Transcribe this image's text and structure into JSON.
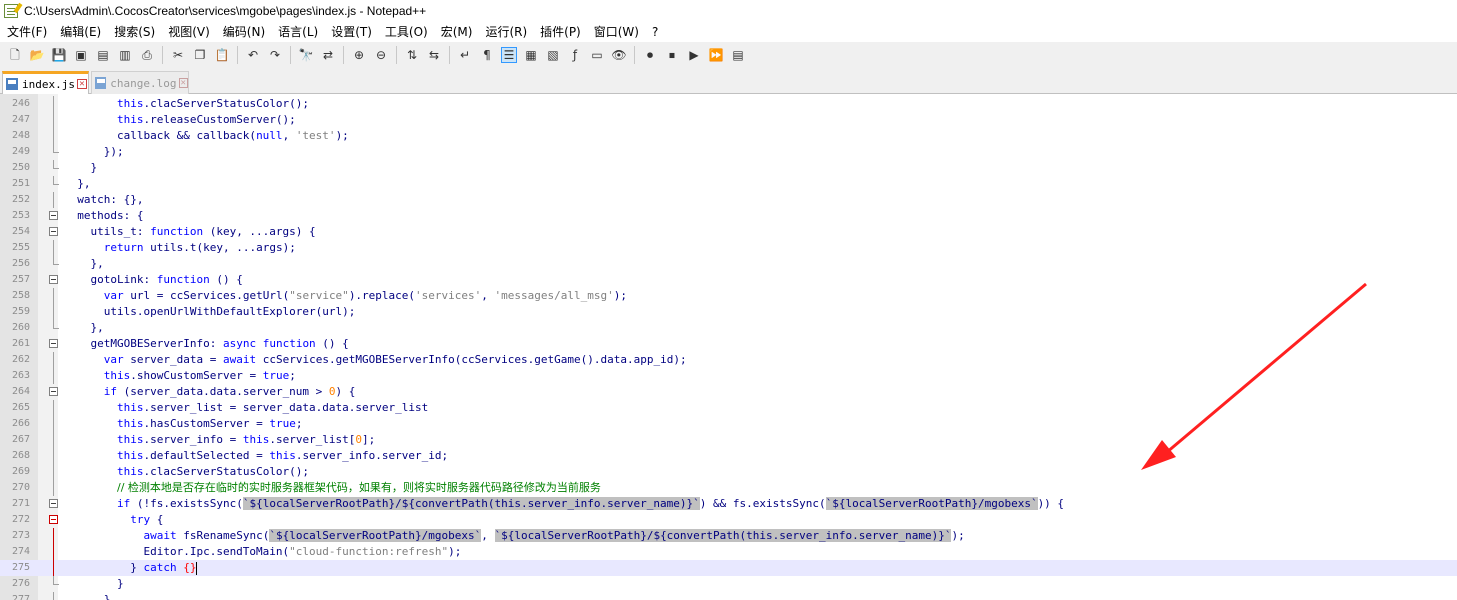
{
  "window": {
    "title": "C:\\Users\\Admin\\.CocosCreator\\services\\mgobe\\pages\\index.js - Notepad++"
  },
  "menu": [
    "文件(F)",
    "编辑(E)",
    "搜索(S)",
    "视图(V)",
    "编码(N)",
    "语言(L)",
    "设置(T)",
    "工具(O)",
    "宏(M)",
    "运行(R)",
    "插件(P)",
    "窗口(W)",
    "?"
  ],
  "tabs": [
    {
      "label": "index.js",
      "close": "✕"
    },
    {
      "label": "change.log",
      "close": "✕"
    }
  ],
  "lines": [
    {
      "num": "246",
      "code": [
        [
          "        ",
          ""
        ],
        [
          "this",
          "kw"
        ],
        [
          ".clacServerStatusColor();",
          ""
        ]
      ]
    },
    {
      "num": "247",
      "code": [
        [
          "        ",
          ""
        ],
        [
          "this",
          "kw"
        ],
        [
          ".releaseCustomServer();",
          ""
        ]
      ]
    },
    {
      "num": "248",
      "code": [
        [
          "        callback && callback(",
          ""
        ],
        [
          "null",
          "kw"
        ],
        [
          ", ",
          ""
        ],
        [
          "'test'",
          "str"
        ],
        [
          ");",
          ""
        ]
      ]
    },
    {
      "num": "249",
      "code": [
        [
          "      });",
          ""
        ]
      ]
    },
    {
      "num": "250",
      "code": [
        [
          "    }",
          ""
        ]
      ]
    },
    {
      "num": "251",
      "code": [
        [
          "  },",
          ""
        ]
      ]
    },
    {
      "num": "252",
      "code": [
        [
          "  watch: {},",
          ""
        ]
      ]
    },
    {
      "num": "253",
      "code": [
        [
          "  methods: {",
          ""
        ]
      ]
    },
    {
      "num": "254",
      "code": [
        [
          "    utils_t: ",
          ""
        ],
        [
          "function",
          "kw"
        ],
        [
          " (key, ...args) {",
          ""
        ]
      ]
    },
    {
      "num": "255",
      "code": [
        [
          "      ",
          ""
        ],
        [
          "return",
          "kw"
        ],
        [
          " utils.t(key, ...args);",
          ""
        ]
      ]
    },
    {
      "num": "256",
      "code": [
        [
          "    },",
          ""
        ]
      ]
    },
    {
      "num": "257",
      "code": [
        [
          "    gotoLink: ",
          ""
        ],
        [
          "function",
          "kw"
        ],
        [
          " () {",
          ""
        ]
      ]
    },
    {
      "num": "258",
      "code": [
        [
          "      ",
          ""
        ],
        [
          "var",
          "kw"
        ],
        [
          " url = ccServices.getUrl(",
          ""
        ],
        [
          "\"service\"",
          "str"
        ],
        [
          ").replace(",
          ""
        ],
        [
          "'services'",
          "str"
        ],
        [
          ", ",
          ""
        ],
        [
          "'messages/all_msg'",
          "str"
        ],
        [
          ");",
          ""
        ]
      ]
    },
    {
      "num": "259",
      "code": [
        [
          "      utils.openUrlWithDefaultExplorer(url);",
          ""
        ]
      ]
    },
    {
      "num": "260",
      "code": [
        [
          "    },",
          ""
        ]
      ]
    },
    {
      "num": "261",
      "code": [
        [
          "    getMGOBEServerInfo: ",
          ""
        ],
        [
          "async",
          "kw"
        ],
        [
          " ",
          ""
        ],
        [
          "function",
          "kw"
        ],
        [
          " () {",
          ""
        ]
      ]
    },
    {
      "num": "262",
      "code": [
        [
          "      ",
          ""
        ],
        [
          "var",
          "kw"
        ],
        [
          " server_data = ",
          ""
        ],
        [
          "await",
          "kw"
        ],
        [
          " ccServices.getMGOBEServerInfo(ccServices.getGame().data.app_id);",
          ""
        ]
      ]
    },
    {
      "num": "263",
      "code": [
        [
          "      ",
          ""
        ],
        [
          "this",
          "kw"
        ],
        [
          ".showCustomServer = ",
          ""
        ],
        [
          "true",
          "kw"
        ],
        [
          ";",
          ""
        ]
      ]
    },
    {
      "num": "264",
      "code": [
        [
          "      ",
          ""
        ],
        [
          "if",
          "kw"
        ],
        [
          " (server_data.data.server_num > ",
          ""
        ],
        [
          "0",
          "num"
        ],
        [
          ") {",
          ""
        ]
      ]
    },
    {
      "num": "265",
      "code": [
        [
          "        ",
          ""
        ],
        [
          "this",
          "kw"
        ],
        [
          ".server_list = server_data.data.server_list",
          ""
        ]
      ]
    },
    {
      "num": "266",
      "code": [
        [
          "        ",
          ""
        ],
        [
          "this",
          "kw"
        ],
        [
          ".hasCustomServer = ",
          ""
        ],
        [
          "true",
          "kw"
        ],
        [
          ";",
          ""
        ]
      ]
    },
    {
      "num": "267",
      "code": [
        [
          "        ",
          ""
        ],
        [
          "this",
          "kw"
        ],
        [
          ".server_info = ",
          ""
        ],
        [
          "this",
          "kw"
        ],
        [
          ".server_list[",
          ""
        ],
        [
          "0",
          "num"
        ],
        [
          "];",
          ""
        ]
      ]
    },
    {
      "num": "268",
      "code": [
        [
          "        ",
          ""
        ],
        [
          "this",
          "kw"
        ],
        [
          ".defaultSelected = ",
          ""
        ],
        [
          "this",
          "kw"
        ],
        [
          ".server_info.server_id;",
          ""
        ]
      ]
    },
    {
      "num": "269",
      "code": [
        [
          "        ",
          ""
        ],
        [
          "this",
          "kw"
        ],
        [
          ".clacServerStatusColor();",
          ""
        ]
      ]
    },
    {
      "num": "270",
      "code": [
        [
          "        ",
          ""
        ],
        [
          "// 检测本地是否存在临时的实时服务器框架代码，如果有，则将实时服务器代码路径修改为当前服务",
          "cmt"
        ]
      ]
    },
    {
      "num": "271",
      "code": [
        [
          "        ",
          ""
        ],
        [
          "if",
          "kw"
        ],
        [
          " (!fs.existsSync(",
          ""
        ],
        [
          "`${localServerRootPath}/${convertPath(this.server_info.server_name)}`",
          "tpl"
        ],
        [
          ") && fs.existsSync(",
          ""
        ],
        [
          "`${localServerRootPath}/mgobexs`",
          "tpl"
        ],
        [
          ")) {",
          ""
        ]
      ]
    },
    {
      "num": "272",
      "code": [
        [
          "          ",
          ""
        ],
        [
          "try",
          "kw"
        ],
        [
          " {",
          ""
        ]
      ]
    },
    {
      "num": "273",
      "code": [
        [
          "            ",
          ""
        ],
        [
          "await",
          "kw"
        ],
        [
          " fsRenameSync(",
          ""
        ],
        [
          "`${localServerRootPath}/mgobexs`",
          "tpl"
        ],
        [
          ", ",
          ""
        ],
        [
          "`${localServerRootPath}/${convertPath(this.server_info.server_name)}`",
          "tpl"
        ],
        [
          ");",
          ""
        ]
      ]
    },
    {
      "num": "274",
      "code": [
        [
          "            Editor.Ipc.sendToMain(",
          ""
        ],
        [
          "\"cloud-function:refresh\"",
          "str"
        ],
        [
          ");",
          ""
        ]
      ]
    },
    {
      "num": "275",
      "code": [
        [
          "          } ",
          ""
        ],
        [
          "catch",
          "kw"
        ],
        [
          " ",
          ""
        ],
        [
          "{}",
          "brace-hl"
        ]
      ]
    },
    {
      "num": "276",
      "code": [
        [
          "        }",
          ""
        ]
      ]
    },
    {
      "num": "277",
      "code": [
        [
          "      }",
          ""
        ]
      ]
    }
  ]
}
